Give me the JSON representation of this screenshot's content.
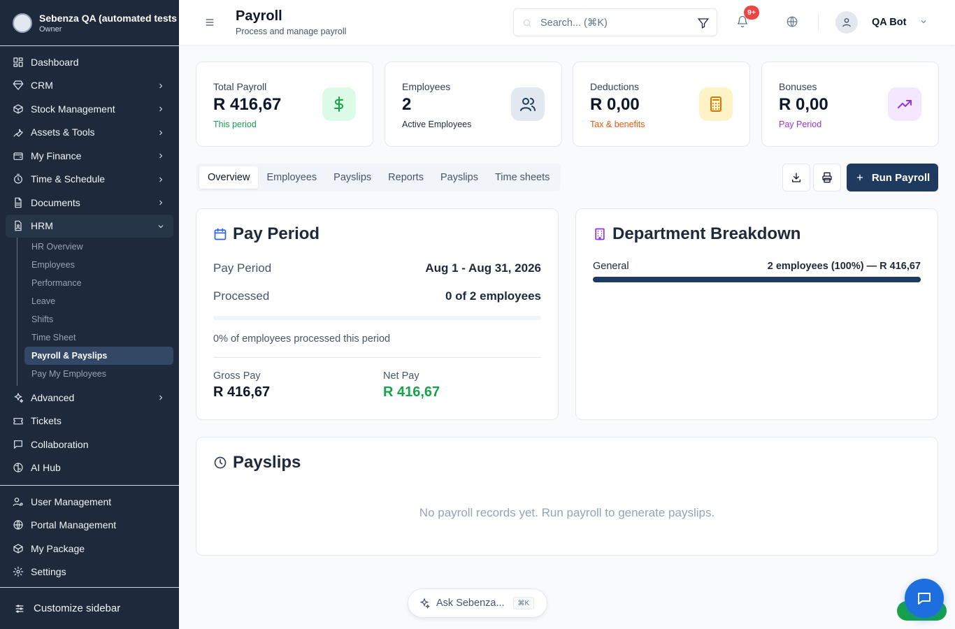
{
  "org": {
    "name": "Sebenza QA (automated tests",
    "role": "Owner"
  },
  "sidebar": {
    "items": [
      {
        "label": "Dashboard",
        "icon": "dashboard-icon"
      },
      {
        "label": "CRM",
        "icon": "gem-icon"
      },
      {
        "label": "Stock Management",
        "icon": "package-icon"
      },
      {
        "label": "Assets & Tools",
        "icon": "wrench-icon"
      },
      {
        "label": "My Finance",
        "icon": "wallet-icon"
      },
      {
        "label": "Time & Schedule",
        "icon": "timer-icon"
      },
      {
        "label": "Documents",
        "icon": "file-icon"
      },
      {
        "label": "HRM",
        "icon": "user-file-icon"
      }
    ],
    "hrm_sub": [
      "HR Overview",
      "Employees",
      "Performance",
      "Leave",
      "Shifts",
      "Time Sheet",
      "Payroll & Payslips",
      "Pay My Employees"
    ],
    "items2": [
      {
        "label": "Advanced",
        "icon": "sparkles-icon"
      },
      {
        "label": "Tickets",
        "icon": "ticket-icon"
      },
      {
        "label": "Collaboration",
        "icon": "message-icon"
      },
      {
        "label": "AI Hub",
        "icon": "brain-icon"
      }
    ],
    "bottom": [
      {
        "label": "User Management",
        "icon": "user-cog-icon"
      },
      {
        "label": "Portal Management",
        "icon": "globe-icon"
      },
      {
        "label": "My Package",
        "icon": "package-icon"
      },
      {
        "label": "Settings",
        "icon": "gear-icon"
      }
    ],
    "customize": "Customize sidebar"
  },
  "header": {
    "title": "Payroll",
    "subtitle": "Process and manage payroll",
    "search_placeholder": "Search... (⌘K)",
    "notif_badge": "9+",
    "user_name": "QA Bot"
  },
  "stats": [
    {
      "label": "Total Payroll",
      "value": "R 416,67",
      "note": "This period",
      "note_color": "#16a34a",
      "icon": "dollar-icon",
      "icon_bg": "#dcfce7",
      "icon_color": "#16a34a"
    },
    {
      "label": "Employees",
      "value": "2",
      "note": "Active Employees",
      "note_color": "#1e293b",
      "icon": "users-icon",
      "icon_bg": "#e2e8f0",
      "icon_color": "#1e3a5f"
    },
    {
      "label": "Deductions",
      "value": "R 0,00",
      "note": "Tax & benefits",
      "note_color": "#ea580c",
      "icon": "calculator-icon",
      "icon_bg": "#fef3c7",
      "icon_color": "#d97706"
    },
    {
      "label": "Bonuses",
      "value": "R 0,00",
      "note": "Pay Period",
      "note_color": "#9333ea",
      "icon": "trending-up-icon",
      "icon_bg": "#f3e8ff",
      "icon_color": "#9333ea"
    }
  ],
  "tabs": [
    "Overview",
    "Employees",
    "Payslips",
    "Reports",
    "Payslips",
    "Time sheets"
  ],
  "actions": {
    "run_payroll": "Run Payroll"
  },
  "pay_period": {
    "title": "Pay Period",
    "period_label": "Pay Period",
    "period_value": "Aug 1 - Aug 31, 2026",
    "processed_label": "Processed",
    "processed_value": "0 of 2 employees",
    "progress_percent": 0,
    "progress_text": "0% of employees processed this period",
    "gross_label": "Gross Pay",
    "gross_value": "R 416,67",
    "net_label": "Net Pay",
    "net_value": "R 416,67"
  },
  "department": {
    "title": "Department Breakdown",
    "rows": [
      {
        "name": "General",
        "info": "2 employees (100%) — R 416,67",
        "percent": 100
      }
    ]
  },
  "payslips": {
    "title": "Payslips",
    "empty": "No payroll records yet. Run payroll to generate payslips."
  },
  "assistant": {
    "label": "Ask Sebenza...",
    "shortcut": "⌘K"
  },
  "colors": {
    "sidebar_bg": "#1e293b",
    "primary": "#1e3a5f",
    "chat": "#1d6fe0"
  }
}
